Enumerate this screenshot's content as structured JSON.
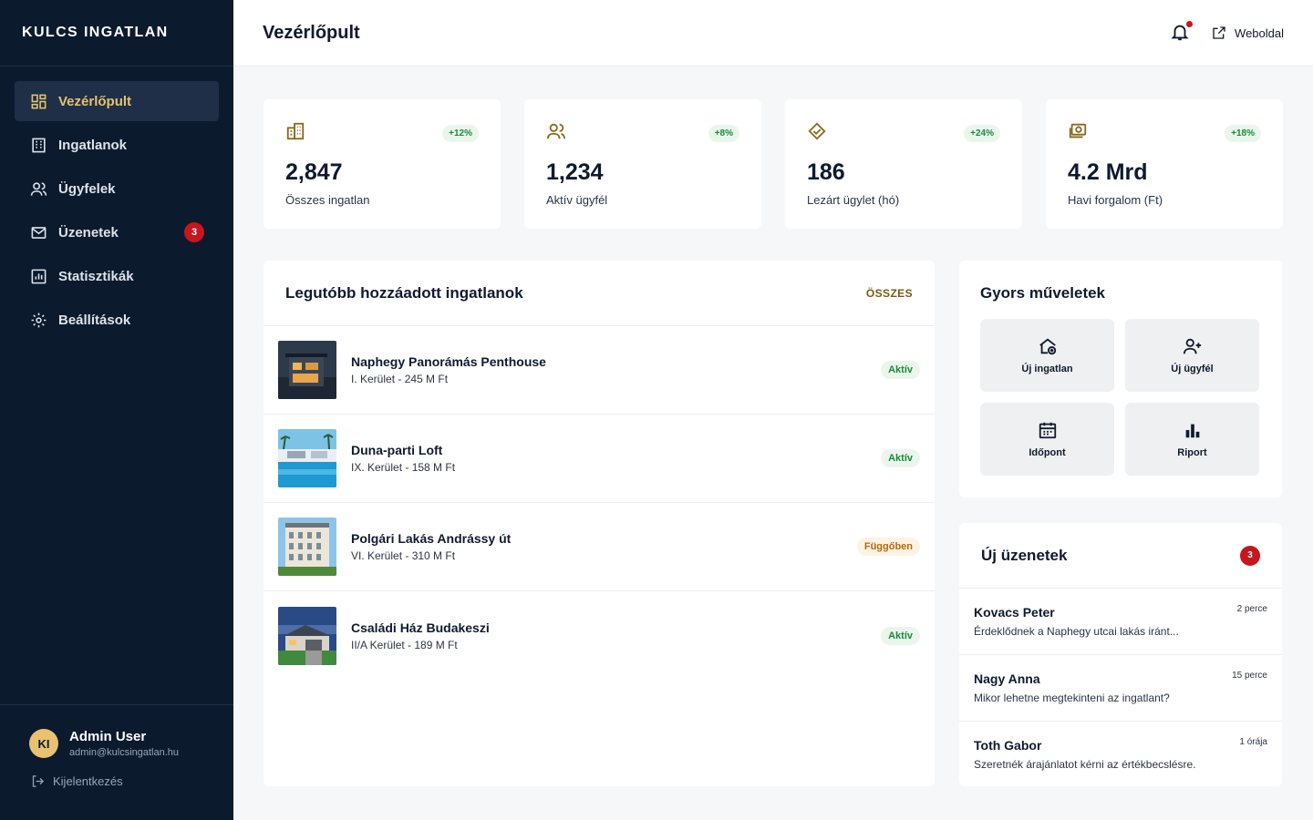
{
  "brand": "KULCS INGATLAN",
  "sidebar": {
    "items": [
      {
        "label": "Vezérlőpult",
        "icon": "dashboard-icon",
        "active": true
      },
      {
        "label": "Ingatlanok",
        "icon": "building-icon"
      },
      {
        "label": "Ügyfelek",
        "icon": "users-icon"
      },
      {
        "label": "Üzenetek",
        "icon": "mail-icon",
        "badge": "3"
      },
      {
        "label": "Statisztikák",
        "icon": "chart-icon"
      },
      {
        "label": "Beállítások",
        "icon": "gear-icon"
      }
    ],
    "user": {
      "initials": "KI",
      "name": "Admin User",
      "email": "admin@kulcsingatlan.hu"
    },
    "logout": "Kijelentkezés"
  },
  "header": {
    "title": "Vezérlőpult",
    "website": "Weboldal"
  },
  "stats": [
    {
      "value": "2,847",
      "label": "Összes ingatlan",
      "change": "+12%",
      "icon": "building-icon"
    },
    {
      "value": "1,234",
      "label": "Aktív ügyfél",
      "change": "+8%",
      "icon": "users-icon"
    },
    {
      "value": "186",
      "label": "Lezárt ügylet (hó)",
      "change": "+24%",
      "icon": "handshake-icon"
    },
    {
      "value": "4.2 Mrd",
      "label": "Havi forgalom (Ft)",
      "change": "+18%",
      "icon": "money-icon"
    }
  ],
  "properties": {
    "title": "Legutóbb hozzáadott ingatlanok",
    "all_label": "ÖSSZES",
    "items": [
      {
        "name": "Naphegy Panorámás Penthouse",
        "meta": "I. Kerület - 245 M Ft",
        "status": "Aktív"
      },
      {
        "name": "Duna-parti Loft",
        "meta": "IX. Kerület - 158 M Ft",
        "status": "Aktív"
      },
      {
        "name": "Polgári Lakás Andrássy út",
        "meta": "VI. Kerület - 310 M Ft",
        "status": "Függőben"
      },
      {
        "name": "Családi Ház Budakeszi",
        "meta": "II/A Kerület - 189 M Ft",
        "status": "Aktív"
      }
    ]
  },
  "quick": {
    "title": "Gyors műveletek",
    "actions": [
      {
        "label": "Új ingatlan",
        "icon": "house-add-icon"
      },
      {
        "label": "Új ügyfél",
        "icon": "user-add-icon"
      },
      {
        "label": "Időpont",
        "icon": "calendar-icon"
      },
      {
        "label": "Riport",
        "icon": "bar-chart-icon"
      }
    ]
  },
  "messages": {
    "title": "Új üzenetek",
    "count": "3",
    "items": [
      {
        "name": "Kovacs Peter",
        "time": "2 perce",
        "text": "Érdeklődnek a Naphegy utcai lakás iránt..."
      },
      {
        "name": "Nagy Anna",
        "time": "15 perce",
        "text": "Mikor lehetne megtekinteni az ingatlant?"
      },
      {
        "name": "Toth Gabor",
        "time": "1 órája",
        "text": "Szeretnék árajánlatot kérni az értékbecslésre."
      }
    ]
  },
  "colors": {
    "sidebar": "#0c1a2e",
    "accent": "#e8c270",
    "badge": "#c8161d",
    "positive": "#1a8a3b"
  }
}
